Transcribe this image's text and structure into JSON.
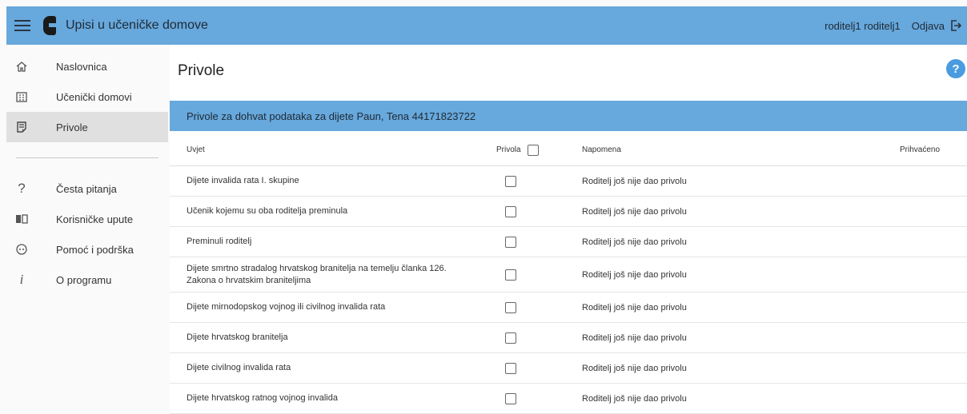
{
  "header": {
    "app_title": "Upisi u učeničke domove",
    "user": "roditelj1 roditelj1",
    "logout_label": "Odjava"
  },
  "sidebar": {
    "items": [
      {
        "label": "Naslovnica",
        "icon": "home-icon"
      },
      {
        "label": "Učenički domovi",
        "icon": "building-icon"
      },
      {
        "label": "Privole",
        "icon": "document-check-icon",
        "active": true
      }
    ],
    "secondary": [
      {
        "label": "Česta pitanja",
        "icon": "question-icon"
      },
      {
        "label": "Korisničke upute",
        "icon": "book-icon"
      },
      {
        "label": "Pomoć i podrška",
        "icon": "support-icon"
      },
      {
        "label": "O programu",
        "icon": "info-icon"
      }
    ]
  },
  "main": {
    "title": "Privole",
    "help_label": "?",
    "panel_title": "Privole za dohvat podataka za dijete Paun, Tena 44171823722",
    "columns": {
      "uvjet": "Uvjet",
      "privola": "Privola",
      "napomena": "Napomena",
      "prihvaceno": "Prihvaćeno"
    },
    "rows": [
      {
        "uvjet": "Dijete invalida rata I. skupine",
        "napomena": "Roditelj još nije dao privolu",
        "privola": false
      },
      {
        "uvjet": "Učenik kojemu su oba roditelja preminula",
        "napomena": "Roditelj još nije dao privolu",
        "privola": false
      },
      {
        "uvjet": "Preminuli roditelj",
        "napomena": "Roditelj još nije dao privolu",
        "privola": false
      },
      {
        "uvjet": "Dijete smrtno stradalog hrvatskog branitelja na temelju članka 126. Zakona o hrvatskim braniteljima",
        "napomena": "Roditelj još nije dao privolu",
        "privola": false
      },
      {
        "uvjet": "Dijete mirnodopskog vojnog ili civilnog invalida rata",
        "napomena": "Roditelj još nije dao privolu",
        "privola": false
      },
      {
        "uvjet": "Dijete hrvatskog branitelja",
        "napomena": "Roditelj još nije dao privolu",
        "privola": false
      },
      {
        "uvjet": "Dijete civilnog invalida rata",
        "napomena": "Roditelj još nije dao privolu",
        "privola": false
      },
      {
        "uvjet": "Dijete hrvatskog ratnog vojnog invalida",
        "napomena": "Roditelj još nije dao privolu",
        "privola": false
      }
    ]
  },
  "colors": {
    "accent": "#67a8dd",
    "help": "#4a9be0",
    "active_nav": "#e0e0e0"
  }
}
